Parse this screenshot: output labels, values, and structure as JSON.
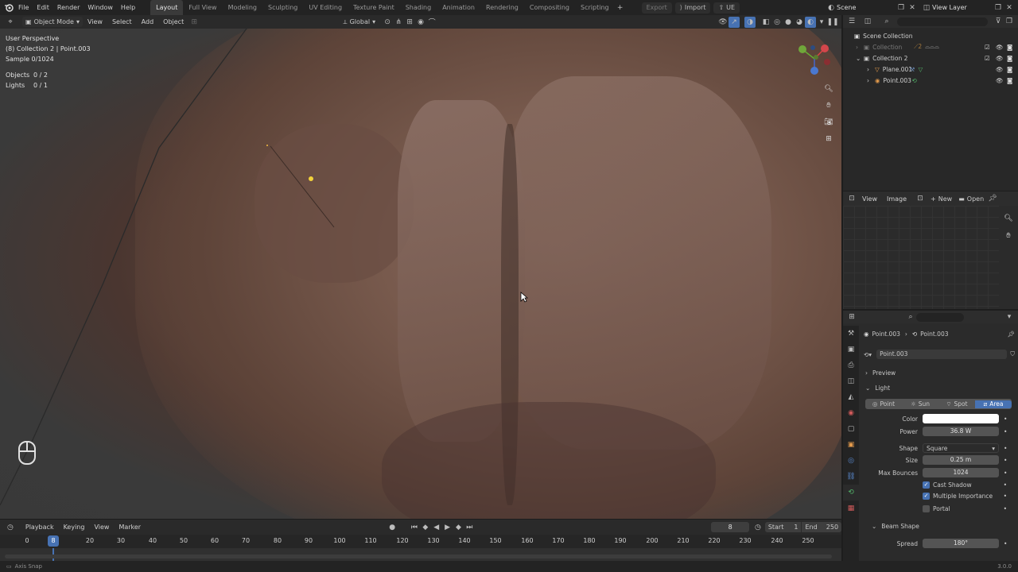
{
  "menu": {
    "items": [
      "File",
      "Edit",
      "Render",
      "Window",
      "Help"
    ],
    "workspaces": [
      "Layout",
      "Full View",
      "Modeling",
      "Sculpting",
      "UV Editing",
      "Texture Paint",
      "Shading",
      "Animation",
      "Rendering",
      "Compositing",
      "Scripting"
    ],
    "active_workspace": "Layout",
    "export_label": "Export",
    "import_label": "Import",
    "ue_label": "UE",
    "scene_label": "Scene",
    "view_layer_label": "View Layer"
  },
  "viewport_header": {
    "mode": "Object Mode",
    "menus": [
      "View",
      "Select",
      "Add",
      "Object"
    ],
    "transform_orientation": "Global"
  },
  "viewport_overlay": {
    "lines": [
      "User Perspective",
      "(8) Collection 2 | Point.003",
      "Sample 0/1024"
    ],
    "stats": [
      {
        "label": "Objects",
        "value": "0 / 2"
      },
      {
        "label": "Lights",
        "value": "0 / 1"
      }
    ]
  },
  "outliner": {
    "root": "Scene Collection",
    "items": [
      {
        "label": "Collection",
        "level": 1,
        "dim": true
      },
      {
        "label": "Collection 2",
        "level": 1,
        "dim": false
      },
      {
        "label": "Plane.001",
        "level": 2,
        "dim": false
      },
      {
        "label": "Point.003",
        "level": 2,
        "dim": false
      }
    ]
  },
  "image_editor": {
    "menus": [
      "View",
      "Image"
    ],
    "new_label": "New",
    "open_label": "Open"
  },
  "properties": {
    "breadcrumb_object": "Point.003",
    "breadcrumb_data": "Point.003",
    "data_name": "Point.003",
    "preview_label": "Preview",
    "light_label": "Light",
    "light_types": [
      "Point",
      "Sun",
      "Spot",
      "Area"
    ],
    "active_light_type": "Area",
    "color_label": "Color",
    "color_value": "#ffffff",
    "power_label": "Power",
    "power_value": "36.8 W",
    "shape_label": "Shape",
    "shape_value": "Square",
    "size_label": "Size",
    "size_value": "0.25 m",
    "bounces_label": "Max Bounces",
    "bounces_value": "1024",
    "cast_shadow_label": "Cast Shadow",
    "cast_shadow": true,
    "multiple_importance_label": "Multiple Importance",
    "multiple_importance": true,
    "portal_label": "Portal",
    "portal": false,
    "beam_shape_label": "Beam Shape",
    "spread_label": "Spread",
    "spread_value": "180°"
  },
  "timeline": {
    "menus": [
      "Playback",
      "Keying",
      "View",
      "Marker"
    ],
    "current_frame": "8",
    "start_label": "Start",
    "start_value": "1",
    "end_label": "End",
    "end_value": "250",
    "ticks": [
      "0",
      "20",
      "30",
      "40",
      "50",
      "60",
      "70",
      "80",
      "90",
      "100",
      "110",
      "120",
      "130",
      "140",
      "150",
      "160",
      "170",
      "180",
      "190",
      "200",
      "210",
      "220",
      "230",
      "240",
      "250"
    ],
    "playhead_label": "8"
  },
  "status": {
    "left": "Axis Snap",
    "version": "3.0.0"
  },
  "colors": {
    "accent_blue": "#4772b3",
    "rock_base": "#7a5a4e",
    "light_dot": "#f2d23a"
  }
}
